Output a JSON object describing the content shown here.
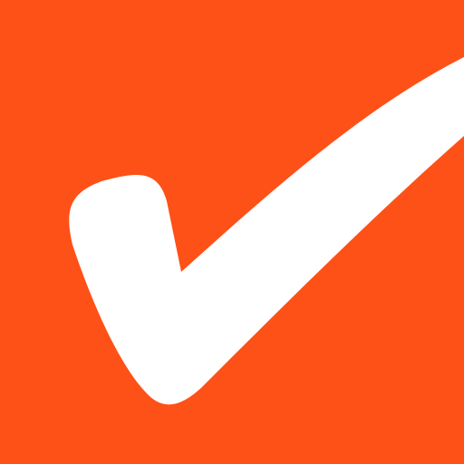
{
  "icon": {
    "name": "checkmark-app-icon",
    "background_color": "#FE5117",
    "mark_color": "#FFFFFF"
  }
}
